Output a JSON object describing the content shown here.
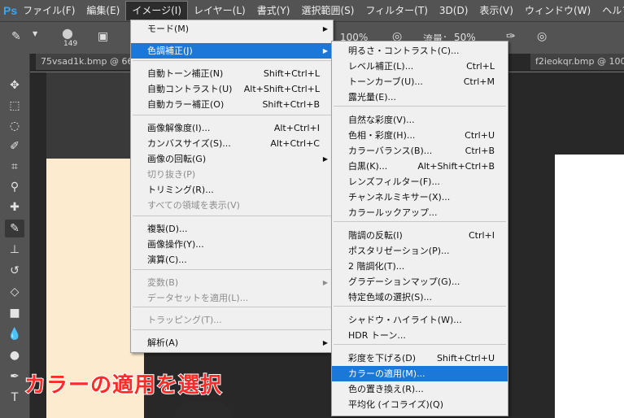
{
  "app": {
    "logo": "Ps"
  },
  "menubar": [
    "ファイル(F)",
    "編集(E)",
    "イメージ(I)",
    "レイヤー(L)",
    "書式(Y)",
    "選択範囲(S)",
    "フィルター(T)",
    "3D(D)",
    "表示(V)",
    "ウィンドウ(W)",
    "ヘルプ(H)"
  ],
  "options": {
    "brush_size": "149",
    "opacity": "100%",
    "flow_label": "流量：",
    "flow_value": "50%"
  },
  "tabs": {
    "left": "75vsad1k.bmp @ 66",
    "right": "f2ieokqr.bmp @ 100"
  },
  "image_menu": [
    {
      "label": "モード(M)",
      "shortcut": "",
      "submenu": true,
      "disabled": false
    },
    {
      "label": "色調補正(J)",
      "shortcut": "",
      "submenu": true,
      "disabled": false,
      "highlight": true
    },
    {
      "label": "自動トーン補正(N)",
      "shortcut": "Shift+Ctrl+L",
      "disabled": false
    },
    {
      "label": "自動コントラスト(U)",
      "shortcut": "Alt+Shift+Ctrl+L",
      "disabled": false
    },
    {
      "label": "自動カラー補正(O)",
      "shortcut": "Shift+Ctrl+B",
      "disabled": false
    },
    {
      "label": "画像解像度(I)...",
      "shortcut": "Alt+Ctrl+I",
      "disabled": false
    },
    {
      "label": "カンバスサイズ(S)...",
      "shortcut": "Alt+Ctrl+C",
      "disabled": false
    },
    {
      "label": "画像の回転(G)",
      "shortcut": "",
      "submenu": true,
      "disabled": false
    },
    {
      "label": "切り抜き(P)",
      "shortcut": "",
      "disabled": true
    },
    {
      "label": "トリミング(R)...",
      "shortcut": "",
      "disabled": false
    },
    {
      "label": "すべての領域を表示(V)",
      "shortcut": "",
      "disabled": true
    },
    {
      "label": "複製(D)...",
      "shortcut": "",
      "disabled": false
    },
    {
      "label": "画像操作(Y)...",
      "shortcut": "",
      "disabled": false
    },
    {
      "label": "演算(C)...",
      "shortcut": "",
      "disabled": false
    },
    {
      "label": "変数(B)",
      "shortcut": "",
      "submenu": true,
      "disabled": true
    },
    {
      "label": "データセットを適用(L)...",
      "shortcut": "",
      "disabled": true
    },
    {
      "label": "トラッピング(T)...",
      "shortcut": "",
      "disabled": true
    },
    {
      "label": "解析(A)",
      "shortcut": "",
      "submenu": true,
      "disabled": false
    }
  ],
  "adjust_menu": [
    {
      "label": "明るさ・コントラスト(C)...",
      "shortcut": ""
    },
    {
      "label": "レベル補正(L)...",
      "shortcut": "Ctrl+L"
    },
    {
      "label": "トーンカーブ(U)...",
      "shortcut": "Ctrl+M"
    },
    {
      "label": "露光量(E)...",
      "shortcut": ""
    },
    {
      "label": "自然な彩度(V)...",
      "shortcut": ""
    },
    {
      "label": "色相・彩度(H)...",
      "shortcut": "Ctrl+U"
    },
    {
      "label": "カラーバランス(B)...",
      "shortcut": "Ctrl+B"
    },
    {
      "label": "白黒(K)...",
      "shortcut": "Alt+Shift+Ctrl+B"
    },
    {
      "label": "レンズフィルター(F)...",
      "shortcut": ""
    },
    {
      "label": "チャンネルミキサー(X)...",
      "shortcut": ""
    },
    {
      "label": "カラールックアップ...",
      "shortcut": ""
    },
    {
      "label": "階調の反転(I)",
      "shortcut": "Ctrl+I"
    },
    {
      "label": "ポスタリゼーション(P)...",
      "shortcut": ""
    },
    {
      "label": "2 階調化(T)...",
      "shortcut": ""
    },
    {
      "label": "グラデーションマップ(G)...",
      "shortcut": ""
    },
    {
      "label": "特定色域の選択(S)...",
      "shortcut": ""
    },
    {
      "label": "シャドウ・ハイライト(W)...",
      "shortcut": ""
    },
    {
      "label": "HDR トーン...",
      "shortcut": ""
    },
    {
      "label": "彩度を下げる(D)",
      "shortcut": "Shift+Ctrl+U"
    },
    {
      "label": "カラーの適用(M)...",
      "shortcut": "",
      "highlight": true
    },
    {
      "label": "色の置き換え(R)...",
      "shortcut": ""
    },
    {
      "label": "平均化 (イコライズ)(Q)",
      "shortcut": ""
    }
  ],
  "caption": "カラーの適用を選択",
  "colors": {
    "accent": "#1b78d8",
    "caption": "#ff2a2a"
  }
}
